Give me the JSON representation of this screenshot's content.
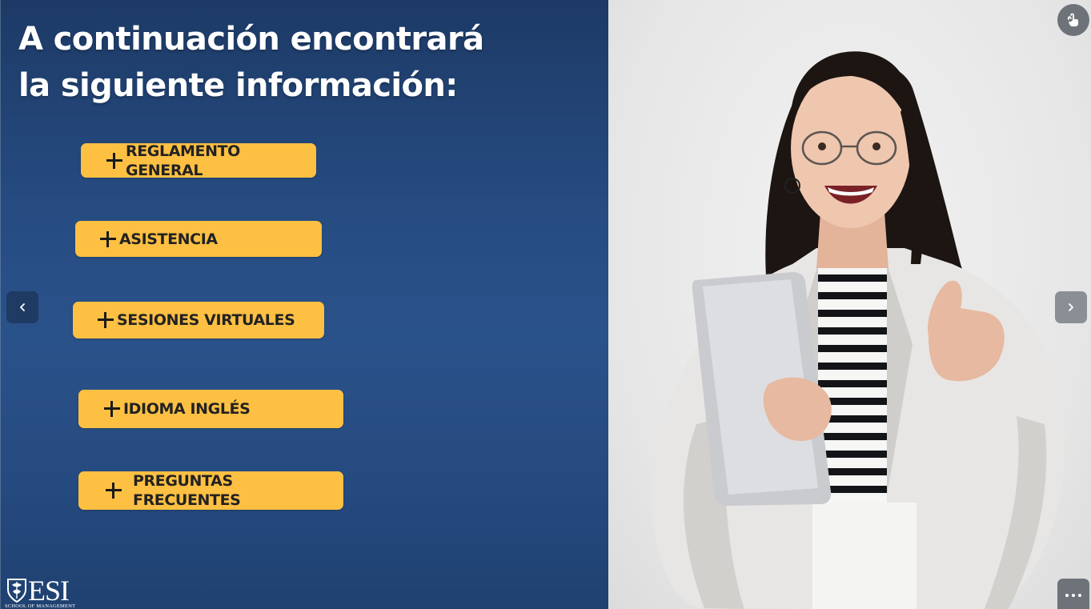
{
  "slide": {
    "title": "A continuación encontrará la siguiente información:",
    "items": [
      {
        "label": "REGLAMENTO GENERAL"
      },
      {
        "label": "ASISTENCIA"
      },
      {
        "label": "SESIONES VIRTUALES"
      },
      {
        "label": "IDIOMA INGLÉS"
      },
      {
        "label": "PREGUNTAS FRECUENTES"
      }
    ],
    "logo": {
      "wordmark": "ESI",
      "tagline": "SCHOOL OF MANAGEMENT"
    }
  },
  "icons": {
    "item": "plus-icon",
    "prev": "chevron-left-icon",
    "next": "chevron-right-icon",
    "top_right": "touch-icon",
    "bottom_right": "more-horizontal-icon",
    "logo": "shield-logo-icon"
  },
  "colors": {
    "panel_top": "#1d3a66",
    "panel_mid": "#2a528a",
    "button": "#fec043",
    "button_text": "#222222",
    "title_text": "#ffffff",
    "nav_prev": "#1f3b63",
    "nav_next": "#8a8f96"
  }
}
